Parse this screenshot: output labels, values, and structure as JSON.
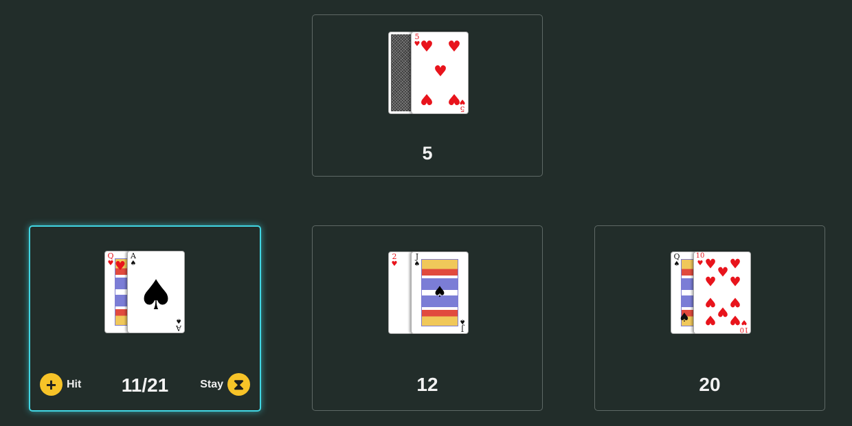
{
  "dealer": {
    "total": "5",
    "cards": [
      {
        "face_down": true,
        "icon": "card-back"
      },
      {
        "rank": "5",
        "suit": "♥",
        "color": "red"
      }
    ]
  },
  "hands": [
    {
      "active": true,
      "total": "11/21",
      "cards": [
        {
          "rank": "Q",
          "suit": "♥",
          "color": "red"
        },
        {
          "rank": "A",
          "suit": "♠",
          "color": "black"
        }
      ],
      "hit_label": "Hit",
      "hit_icon": "plus-icon",
      "stay_label": "Stay",
      "stay_icon": "hourglass-icon"
    },
    {
      "active": false,
      "total": "12",
      "cards": [
        {
          "rank": "2",
          "suit": "♥",
          "color": "red"
        },
        {
          "rank": "J",
          "suit": "♠",
          "color": "black"
        }
      ]
    },
    {
      "active": false,
      "total": "20",
      "cards": [
        {
          "rank": "Q",
          "suit": "♠",
          "color": "black"
        },
        {
          "rank": "10",
          "suit": "♥",
          "color": "red"
        }
      ]
    }
  ],
  "colors": {
    "table": "#222d2a",
    "panel_border": "#5f6966",
    "active_border": "#41d6e3",
    "button": "#f7c328"
  },
  "glyphs": {
    "plus": "+",
    "hourglass": "⧗"
  }
}
